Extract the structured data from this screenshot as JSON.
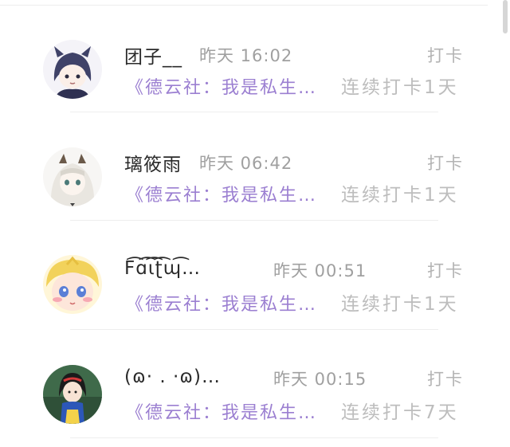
{
  "items": [
    {
      "name": "团子__",
      "time": "昨天 16:02",
      "action": "打卡",
      "content": "《德云社：我是私生…",
      "streak": "连续打卡1天"
    },
    {
      "name": "璃筱雨",
      "time": "昨天 06:42",
      "action": "打卡",
      "content": "《德云社：我是私生…",
      "streak": "连续打卡1天"
    },
    {
      "name": "F͡ɑ͡ι͡ʈ͡ɰ͡…",
      "time": "昨天 00:51",
      "action": "打卡",
      "content": "《德云社：我是私生…",
      "streak": "连续打卡1天"
    },
    {
      "name": "(ɷ·  .  ·ɷ)…",
      "time": "昨天 00:15",
      "action": "打卡",
      "content": "《德云社：我是私生…",
      "streak": "连续打卡7天"
    }
  ]
}
